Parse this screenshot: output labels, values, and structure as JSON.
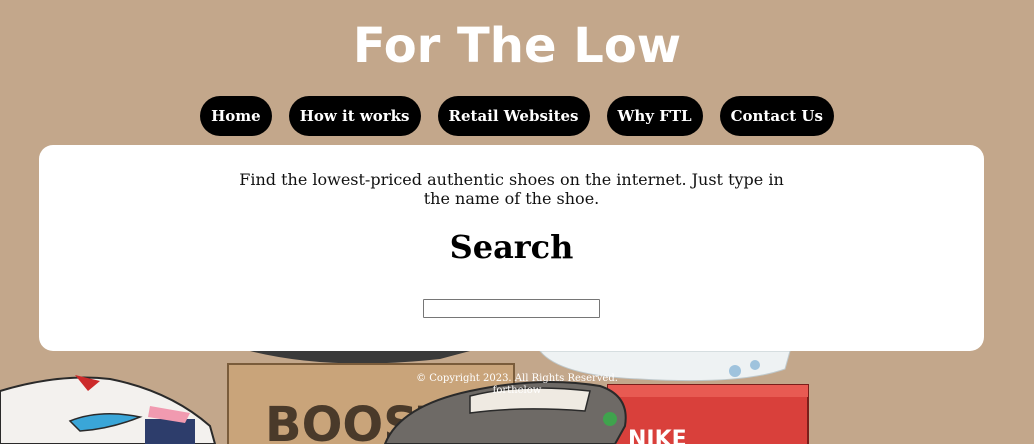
{
  "header": {
    "title": "For The Low"
  },
  "nav": {
    "items": [
      {
        "label": "Home"
      },
      {
        "label": "How it works"
      },
      {
        "label": "Retail Websites"
      },
      {
        "label": "Why FTL"
      },
      {
        "label": "Contact Us"
      }
    ]
  },
  "main": {
    "tagline": "Find the lowest-priced authentic shoes on the internet. Just type in the name of the shoe.",
    "search_heading": "Search",
    "search_value": ""
  },
  "footer": {
    "copyright": "© Copyright 2023. All Rights Reserved.",
    "site": "forthelow"
  },
  "artwork": {
    "box_text": "BOOST",
    "red_box_text": "NIKE"
  },
  "colors": {
    "background": "#c3a78b",
    "nav_button": "#000000",
    "panel": "#ffffff"
  }
}
